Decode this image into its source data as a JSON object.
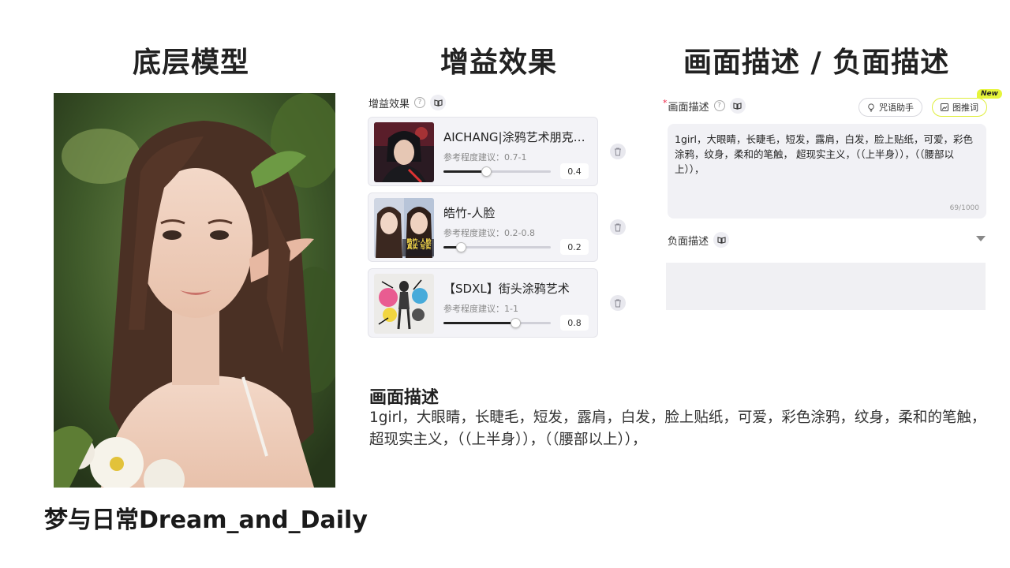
{
  "headings": {
    "model": "底层模型",
    "gain": "增益效果",
    "desc": "画面描述 / 负面描述"
  },
  "portrait": {
    "caption": "梦与日常Dream_and_Daily"
  },
  "gain_panel": {
    "label": "增益效果",
    "help_icon": "question-icon",
    "book_icon": "book-icon",
    "cards": [
      {
        "title": "AICHANG|涂鸦艺术朋克风...",
        "hint": "参考程度建议：0.7-1",
        "value": "0.4",
        "level": 0.4,
        "thumb_icon": "anime-punk-thumbnail"
      },
      {
        "title": "皓竹-人脸",
        "hint": "参考程度建议：0.2-0.8",
        "value": "0.2",
        "level": 0.2,
        "thumb_icon": "face-thumbnail",
        "thumb_text": "皓竹-人脸 真实 写实"
      },
      {
        "title": "【SDXL】街头涂鸦艺术",
        "hint": "参考程度建议：1-1",
        "value": "0.8",
        "level": 0.8,
        "thumb_icon": "graffiti-thumbnail"
      }
    ],
    "delete_icon": "trash-icon"
  },
  "desc_panel": {
    "required_mark": "*",
    "label": "画面描述",
    "assistant_label": "咒语助手",
    "img2prompt_label": "图推词",
    "new_badge": "New",
    "prompt": "1girl，大眼睛，长睫毛，短发，露肩，白发，脸上贴纸，可爱，彩色涂鸦，纹身，柔和的笔触， 超现实主义，（（上半身）），（（腰部以上）），",
    "counter": "69/1000",
    "negative_label": "负面描述",
    "negative_value": ""
  },
  "summary": {
    "title": "画面描述",
    "body": "1girl，大眼睛，长睫毛，短发，露肩，白发，脸上贴纸，可爱，彩色涂鸦，纹身，柔和的笔触， 超现实主义，（（上半身）），（（腰部以上）），"
  },
  "colors": {
    "accent_badge": "#e6f53a",
    "card_bg": "#f3f3f7",
    "slider_fill": "#222222"
  }
}
